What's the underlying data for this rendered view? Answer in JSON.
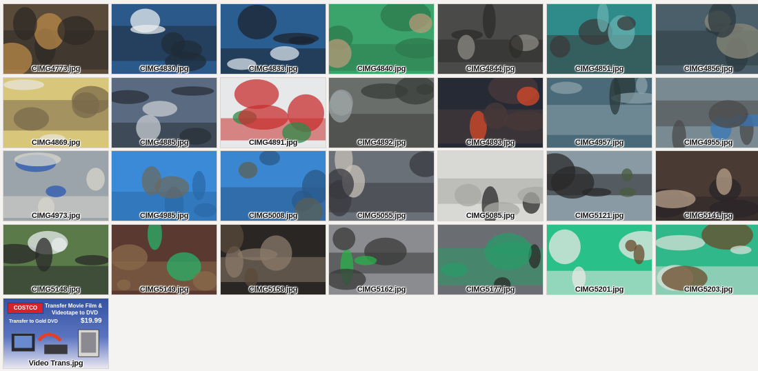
{
  "thumbnails": [
    {
      "caption": "CIMG4773.jpg",
      "icon": "photo-icon",
      "palette": [
        "#5a4a3a",
        "#b88a4a",
        "#2e2a26"
      ]
    },
    {
      "caption": "CIMG4830.jpg",
      "icon": "photo-icon",
      "palette": [
        "#2b5a8a",
        "#e8ecef",
        "#1f2c3a"
      ]
    },
    {
      "caption": "CIMG4833.jpg",
      "icon": "photo-icon",
      "palette": [
        "#2a5d90",
        "#d9e2ea",
        "#1c2430"
      ]
    },
    {
      "caption": "CIMG4840.jpg",
      "icon": "photo-icon",
      "palette": [
        "#3aa46a",
        "#b89a78",
        "#2e7a4e"
      ]
    },
    {
      "caption": "CIMG4844.jpg",
      "icon": "photo-icon",
      "palette": [
        "#4a4a48",
        "#8c8a84",
        "#2c2c2a"
      ]
    },
    {
      "caption": "CIMG4851.jpg",
      "icon": "photo-icon",
      "palette": [
        "#2f8a8a",
        "#6ab0b0",
        "#3a3a3a"
      ]
    },
    {
      "caption": "CIMG4856.jpg",
      "icon": "photo-icon",
      "palette": [
        "#4a5f6a",
        "#8a8a7a",
        "#2d3a40"
      ]
    },
    {
      "caption": "CIMG4869.jpg",
      "icon": "photo-icon",
      "palette": [
        "#d8c67a",
        "#e8e4dc",
        "#7a6a4a"
      ]
    },
    {
      "caption": "CIMG4885.jpg",
      "icon": "photo-icon",
      "palette": [
        "#5a6a80",
        "#c8ccd2",
        "#2a3038"
      ]
    },
    {
      "caption": "CIMG4891.jpg",
      "icon": "photo-icon",
      "palette": [
        "#e6e8ea",
        "#2d8a4a",
        "#c83030"
      ]
    },
    {
      "caption": "CIMG4892.jpg",
      "icon": "photo-icon",
      "palette": [
        "#6a6e6a",
        "#9aa0a0",
        "#3a3e3a"
      ]
    },
    {
      "caption": "CIMG4893.jpg",
      "icon": "photo-icon",
      "palette": [
        "#262a34",
        "#d84a2a",
        "#4a3a3a"
      ]
    },
    {
      "caption": "CIMG4957.jpg",
      "icon": "photo-icon",
      "palette": [
        "#4a6a7a",
        "#2a3a3a",
        "#8aa0a8"
      ]
    },
    {
      "caption": "CIMG4955.jpg",
      "icon": "photo-icon",
      "palette": [
        "#7a8a92",
        "#3a78b8",
        "#4a4a4a"
      ]
    },
    {
      "caption": "CIMG4973.jpg",
      "icon": "photo-icon",
      "palette": [
        "#9aa4aa",
        "#2a5ab0",
        "#d8d6cc"
      ]
    },
    {
      "caption": "CIMG4985.jpg",
      "icon": "photo-icon",
      "palette": [
        "#3a8ad8",
        "#6a6a62",
        "#2a6aa8"
      ]
    },
    {
      "caption": "CIMG5008.jpg",
      "icon": "photo-icon",
      "palette": [
        "#3a86d0",
        "#5a6056",
        "#2a5a8a"
      ]
    },
    {
      "caption": "CIMG5055.jpg",
      "icon": "photo-icon",
      "palette": [
        "#6a7078",
        "#c8c2b8",
        "#3a3a40"
      ]
    },
    {
      "caption": "CIMG5085.jpg",
      "icon": "photo-icon",
      "palette": [
        "#d8d8d4",
        "#2a2a2a",
        "#a8a8a4"
      ]
    },
    {
      "caption": "CIMG5121.jpg",
      "icon": "photo-icon",
      "palette": [
        "#8a9aa4",
        "#4a5a40",
        "#2a2a2a"
      ]
    },
    {
      "caption": "CIMG5141.jpg",
      "icon": "photo-icon",
      "palette": [
        "#4a3a34",
        "#b8a08a",
        "#2a2628"
      ]
    },
    {
      "caption": "CIMG5148.jpg",
      "icon": "photo-icon",
      "palette": [
        "#5a7a4a",
        "#e8ecee",
        "#2a2a2a"
      ]
    },
    {
      "caption": "CIMG5149.jpg",
      "icon": "photo-icon",
      "palette": [
        "#5a3a30",
        "#2ab06a",
        "#8a6a4a"
      ]
    },
    {
      "caption": "CIMG5158.jpg",
      "icon": "photo-icon",
      "palette": [
        "#2a2624",
        "#5a4a3a",
        "#8a7a6a"
      ]
    },
    {
      "caption": "CIMG5162.jpg",
      "icon": "photo-icon",
      "palette": [
        "#8a8c90",
        "#2ab04a",
        "#3a3a3a"
      ]
    },
    {
      "caption": "CIMG5177.jpg",
      "icon": "photo-icon",
      "palette": [
        "#6a6e72",
        "#2a2a2a",
        "#2a9a6a"
      ]
    },
    {
      "caption": "CIMG5201.jpg",
      "icon": "photo-icon",
      "palette": [
        "#2ac08a",
        "#6a4a2a",
        "#e8e8e4"
      ]
    },
    {
      "caption": "CIMG5203.jpg",
      "icon": "photo-icon",
      "palette": [
        "#30b88a",
        "#6a4a2a",
        "#d8e0d8"
      ]
    }
  ],
  "costco_ad": {
    "caption": "Video Trans.jpg",
    "logo": "COSTCO",
    "line1": "Transfer Movie Film &",
    "line2": "Videotape to DVD",
    "price": "$19.99",
    "small": "Transfer to Gold DVD"
  },
  "colors": {
    "background": "#f4f3f1",
    "ad_blue": "#3552a0",
    "ad_red": "#d6232a"
  }
}
